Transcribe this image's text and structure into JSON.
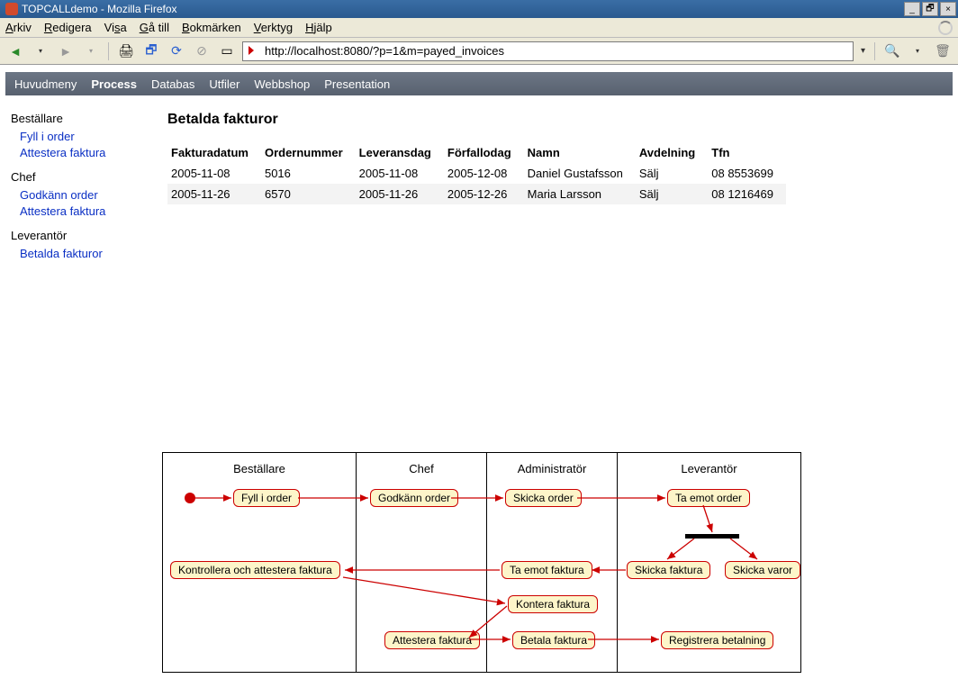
{
  "window": {
    "title": "TOPCALLdemo - Mozilla Firefox",
    "min": "_",
    "rest": "🗗",
    "close": "×"
  },
  "menubar": {
    "arkiv": "Arkiv",
    "redigera": "Redigera",
    "visa": "Visa",
    "gatill": "Gå till",
    "bokmarken": "Bokmärken",
    "verktyg": "Verktyg",
    "hjalp": "Hjälp"
  },
  "toolbar": {
    "back": "◄",
    "fwd": "►",
    "print": "🖨",
    "newtab": "🗗",
    "reload": "⟳",
    "stop": "⊘",
    "home": "▭",
    "url": "http://localhost:8080/?p=1&m=payed_invoices",
    "dropdown": "▾",
    "search": "🔍",
    "trash": "🗑"
  },
  "nav": {
    "items": [
      {
        "label": "Huvudmeny",
        "active": false
      },
      {
        "label": "Process",
        "active": true
      },
      {
        "label": "Databas",
        "active": false
      },
      {
        "label": "Utfiler",
        "active": false
      },
      {
        "label": "Webbshop",
        "active": false
      },
      {
        "label": "Presentation",
        "active": false
      }
    ]
  },
  "sidebar": {
    "g1_head": "Beställare",
    "g1_l1": "Fyll i order",
    "g1_l2": "Attestera faktura",
    "g2_head": "Chef",
    "g2_l1": "Godkänn order",
    "g2_l2": "Attestera faktura",
    "g3_head": "Leverantör",
    "g3_l1": "Betalda fakturor"
  },
  "main": {
    "title": "Betalda fakturor",
    "headers": {
      "c1": "Fakturadatum",
      "c2": "Ordernummer",
      "c3": "Leveransdag",
      "c4": "Förfallodag",
      "c5": "Namn",
      "c6": "Avdelning",
      "c7": "Tfn"
    },
    "rows": [
      {
        "c1": "2005-11-08",
        "c2": "5016",
        "c3": "2005-11-08",
        "c4": "2005-12-08",
        "c5": "Daniel Gustafsson",
        "c6": "Sälj",
        "c7": "08 8553699"
      },
      {
        "c1": "2005-11-26",
        "c2": "6570",
        "c3": "2005-11-26",
        "c4": "2005-12-26",
        "c5": "Maria Larsson",
        "c6": "Sälj",
        "c7": "08 1216469"
      }
    ]
  },
  "diagram": {
    "lanes": {
      "l1": "Beställare",
      "l2": "Chef",
      "l3": "Administratör",
      "l4": "Leverantör"
    },
    "nodes": {
      "fyll": "Fyll i order",
      "godk": "Godkänn order",
      "skicka_o": "Skicka order",
      "ta_o": "Ta emot order",
      "skicka_f": "Skicka faktura",
      "skicka_v": "Skicka varor",
      "ta_f": "Ta emot faktura",
      "kontrollera": "Kontrollera och attestera faktura",
      "kontera": "Kontera faktura",
      "attestera": "Attestera faktura",
      "betala": "Betala faktura",
      "registrera": "Registrera betalning"
    }
  }
}
